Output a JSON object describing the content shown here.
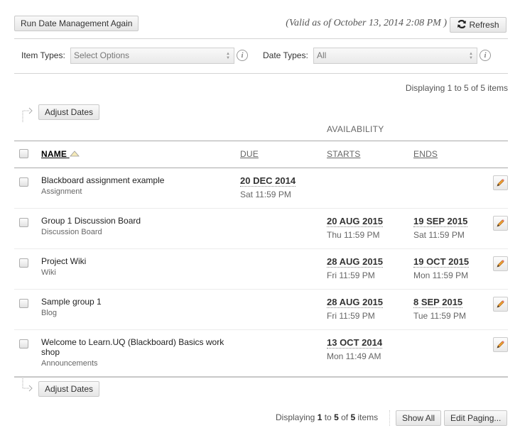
{
  "toolbar": {
    "run_again_label": "Run Date Management Again",
    "valid_as_of": "(Valid as of October 13, 2014 2:08 PM )",
    "refresh_label": "Refresh"
  },
  "filters": {
    "item_types_label": "Item Types:",
    "item_types_value": "Select Options",
    "date_types_label": "Date Types:",
    "date_types_value": "All",
    "info_glyph": "i"
  },
  "paging_top": {
    "text": "Displaying 1 to 5 of 5 items"
  },
  "actions": {
    "adjust_dates_label": "Adjust Dates"
  },
  "table": {
    "group_header": "AVAILABILITY",
    "columns": {
      "name": "NAME",
      "due": "DUE",
      "starts": "STARTS",
      "ends": "ENDS"
    },
    "sort": {
      "column": "name",
      "direction": "ascending"
    },
    "rows": [
      {
        "title": "Blackboard assignment example",
        "type": "Assignment",
        "due_date": "20 DEC 2014",
        "due_time": "Sat 11:59 PM",
        "start_date": "",
        "start_time": "",
        "end_date": "",
        "end_time": ""
      },
      {
        "title": "Group 1 Discussion Board",
        "type": "Discussion Board",
        "due_date": "",
        "due_time": "",
        "start_date": "20 AUG 2015",
        "start_time": "Thu 11:59 PM",
        "end_date": "19 SEP 2015",
        "end_time": "Sat 11:59 PM"
      },
      {
        "title": "Project Wiki",
        "type": "Wiki",
        "due_date": "",
        "due_time": "",
        "start_date": "28 AUG 2015",
        "start_time": "Fri 11:59 PM",
        "end_date": "19 OCT 2015",
        "end_time": "Mon 11:59 PM"
      },
      {
        "title": "Sample group 1",
        "type": "Blog",
        "due_date": "",
        "due_time": "",
        "start_date": "28 AUG 2015",
        "start_time": "Fri 11:59 PM",
        "end_date": "8 SEP 2015",
        "end_time": "Tue 11:59 PM"
      },
      {
        "title": "Welcome to Learn.UQ (Blackboard) Basics work shop",
        "type": "Announcements",
        "due_date": "",
        "due_time": "",
        "start_date": "13 OCT 2014",
        "start_time": "Mon 11:49 AM",
        "end_date": "",
        "end_time": ""
      }
    ]
  },
  "paging_bottom": {
    "prefix": "Displaying ",
    "from": "1",
    "to_word": " to ",
    "to": "5",
    "of_word": " of ",
    "total": "5",
    "suffix": " items",
    "show_all_label": "Show All",
    "edit_paging_label": "Edit Paging..."
  },
  "colors": {
    "pencil": "#f0a030",
    "pencil_tip": "#e87a8a",
    "sort_arrow": "#f5e9b8"
  }
}
